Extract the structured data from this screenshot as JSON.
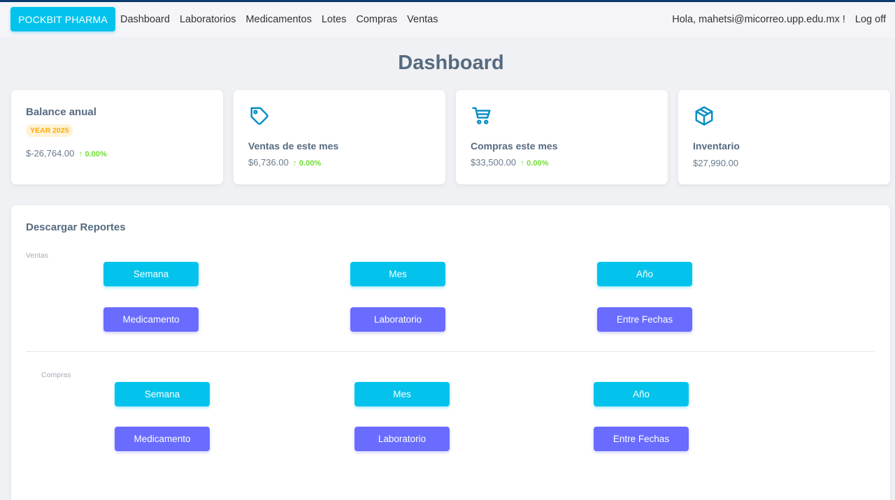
{
  "navbar": {
    "brand": "POCKBIT PHARMA",
    "links": [
      "Dashboard",
      "Laboratorios",
      "Medicamentos",
      "Lotes",
      "Compras",
      "Ventas"
    ],
    "greeting": "Hola, mahetsi@micorreo.upp.edu.mx !",
    "logoff": "Log off"
  },
  "page": {
    "title": "Dashboard"
  },
  "stats": {
    "balance": {
      "title": "Balance anual",
      "badge": "YEAR 2025",
      "amount": "$-26,764.00",
      "change": "0.00%"
    },
    "ventas": {
      "title": "Ventas de este mes",
      "amount": "$6,736.00",
      "change": "0.00%",
      "icon": "tag-icon"
    },
    "compras": {
      "title": "Compras este mes",
      "amount": "$33,500.00",
      "change": "0.00%",
      "icon": "cart-icon"
    },
    "inventario": {
      "title": "Inventario",
      "amount": "$27,990.00",
      "icon": "box-icon"
    }
  },
  "reports": {
    "title": "Descargar Reportes",
    "ventas": {
      "label": "Ventas",
      "buttons": [
        "Semana",
        "Mes",
        "Año",
        "Medicamento",
        "Laboratorio",
        "Entre Fechas"
      ]
    },
    "compras": {
      "label": "Compras",
      "buttons": [
        "Semana",
        "Mes",
        "Año",
        "Medicamento",
        "Laboratorio",
        "Entre Fechas"
      ]
    }
  },
  "colors": {
    "info": "#03c3ec",
    "primary": "#696cff",
    "success": "#71dd37",
    "warning": "#ffab00"
  }
}
